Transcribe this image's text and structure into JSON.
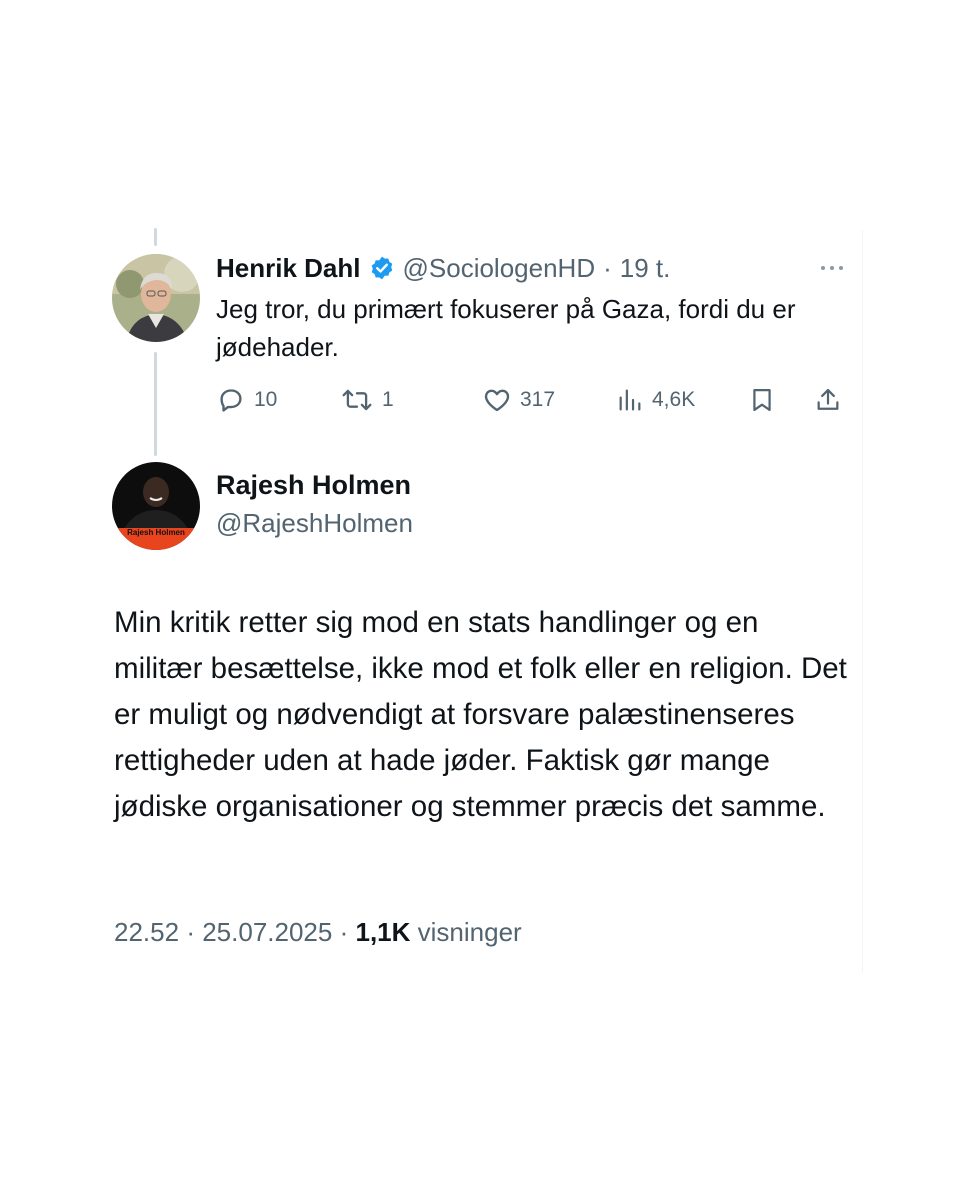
{
  "parent_tweet": {
    "author_name": "Henrik Dahl",
    "handle": "@SociologenHD",
    "separator": "·",
    "time": "19 t.",
    "text": "Jeg tror, du primært fokuserer på Gaza, fordi du er jødehader.",
    "stats": {
      "replies": "10",
      "retweets": "1",
      "likes": "317",
      "views": "4,6K"
    },
    "icons": [
      "verified-badge-icon",
      "more-options-icon",
      "reply-icon",
      "retweet-icon",
      "like-icon",
      "views-icon",
      "bookmark-icon",
      "share-icon"
    ]
  },
  "main_tweet": {
    "author_name": "Rajesh Holmen",
    "handle": "@RajeshHolmen",
    "avatar_text": "Rajesh Holmen",
    "text": "Min kritik retter sig mod en stats handlinger og en militær besættelse, ikke mod et folk eller en religion. Det er muligt og nødvendigt at forsvare palæstinenseres rettigheder uden at hade jøder. Faktisk gør mange jødiske organisationer og stemmer præcis det samme.",
    "time": "22.52",
    "separator": "·",
    "date": "25.07.2025",
    "views_count": "1,1K",
    "views_label": "visninger"
  },
  "colors": {
    "text_primary": "#0f1419",
    "text_secondary": "#536471",
    "verified_blue": "#1d9bf0",
    "thread_line": "#cfd9de",
    "avatar_banner_red": "#e8451f"
  }
}
